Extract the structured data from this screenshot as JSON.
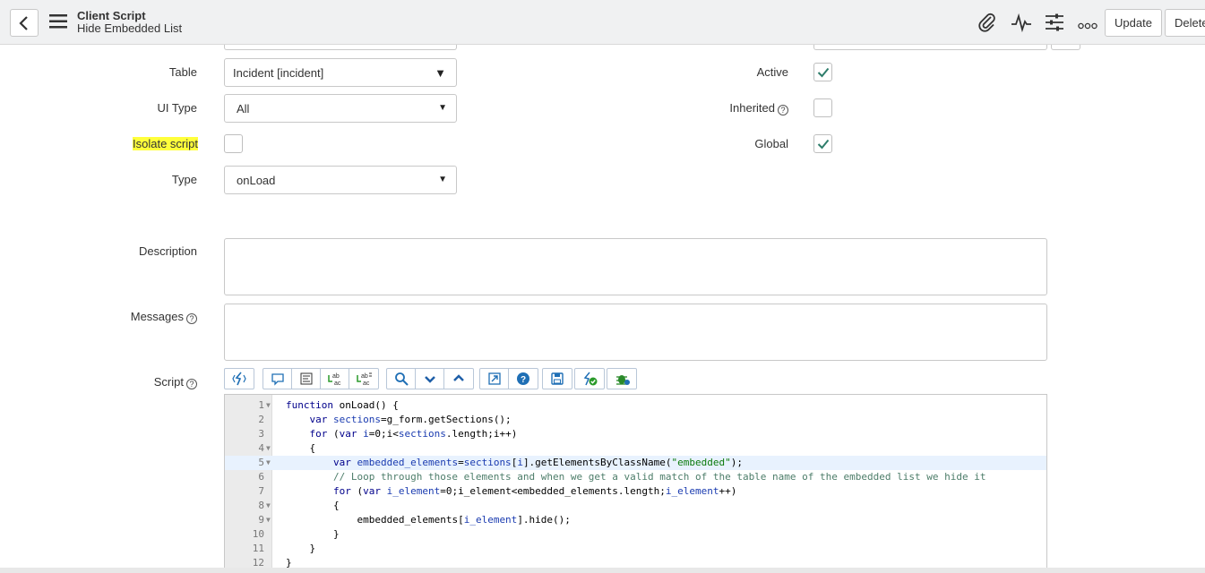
{
  "header": {
    "title": "Client Script",
    "subtitle": "Hide Embedded List",
    "update_label": "Update",
    "delete_label": "Delete"
  },
  "form": {
    "table": {
      "label": "Table",
      "value": "Incident [incident]"
    },
    "ui_type": {
      "label": "UI Type",
      "value": "All"
    },
    "isolate_script": {
      "label": "Isolate script",
      "checked": false
    },
    "type": {
      "label": "Type",
      "value": "onLoad"
    },
    "active": {
      "label": "Active",
      "checked": true
    },
    "inherited": {
      "label": "Inherited",
      "checked": false
    },
    "global": {
      "label": "Global",
      "checked": true
    },
    "description": {
      "label": "Description",
      "value": ""
    },
    "messages": {
      "label": "Messages",
      "value": ""
    },
    "script": {
      "label": "Script"
    }
  },
  "colors": {
    "highlight": "#ffff3b",
    "check": "#2e7d6b",
    "active_line": "#e8f2fe",
    "toolbar_icon": "#1f6fb5"
  },
  "script_toolbar": [
    [
      "toggle-syntax-editor-icon"
    ],
    [
      "comment-icon",
      "format-code-icon",
      "replace-icon",
      "replace-all-icon"
    ],
    [
      "search-icon",
      "search-next-icon",
      "search-prev-icon"
    ],
    [
      "fullscreen-icon",
      "help-icon"
    ],
    [
      "save-icon"
    ],
    [
      "script-check-icon"
    ],
    [
      "debug-icon"
    ]
  ],
  "code_lines": [
    {
      "n": "1",
      "fold": true,
      "indent": "",
      "tokens": [
        [
          "kw",
          "function"
        ],
        [
          "",
          " onLoad() {"
        ]
      ]
    },
    {
      "n": "2",
      "fold": false,
      "indent": "    ",
      "tokens": [
        [
          "kw",
          "var"
        ],
        [
          "",
          " "
        ],
        [
          "var",
          "sections"
        ],
        [
          "",
          "=g_form.getSections();"
        ]
      ]
    },
    {
      "n": "3",
      "fold": false,
      "indent": "    ",
      "tokens": [
        [
          "kw",
          "for"
        ],
        [
          "",
          " ("
        ],
        [
          "kw",
          "var"
        ],
        [
          "",
          " "
        ],
        [
          "var",
          "i"
        ],
        [
          "",
          "=0;i<"
        ],
        [
          "var",
          "sections"
        ],
        [
          "",
          ".length;i++)"
        ]
      ]
    },
    {
      "n": "4",
      "fold": true,
      "indent": "    ",
      "tokens": [
        [
          "",
          "{"
        ]
      ]
    },
    {
      "n": "5",
      "fold": true,
      "indent": "        ",
      "active": true,
      "tokens": [
        [
          "kw",
          "var"
        ],
        [
          "",
          " "
        ],
        [
          "var",
          "embedded_elements"
        ],
        [
          "",
          "="
        ],
        [
          "var",
          "sections"
        ],
        [
          "",
          "["
        ],
        [
          "var",
          "i"
        ],
        [
          "",
          "].getElementsByClassName("
        ],
        [
          "str",
          "\"embedded\""
        ],
        [
          "",
          ");"
        ]
      ]
    },
    {
      "n": "6",
      "fold": false,
      "indent": "        ",
      "tokens": [
        [
          "cmt",
          "// Loop through those elements and when we get a valid match of the table name of the embedded list we hide it"
        ]
      ]
    },
    {
      "n": "7",
      "fold": false,
      "indent": "        ",
      "tokens": [
        [
          "kw",
          "for"
        ],
        [
          "",
          " ("
        ],
        [
          "kw",
          "var"
        ],
        [
          "",
          " "
        ],
        [
          "var",
          "i_element"
        ],
        [
          "",
          "=0;i_element<embedded_elements.length;"
        ],
        [
          "var",
          "i_element"
        ],
        [
          "",
          "++)"
        ]
      ]
    },
    {
      "n": "8",
      "fold": true,
      "indent": "        ",
      "tokens": [
        [
          "",
          "{"
        ]
      ]
    },
    {
      "n": "9",
      "fold": true,
      "indent": "            ",
      "tokens": [
        [
          "",
          "embedded_elements["
        ],
        [
          "var",
          "i_element"
        ],
        [
          "",
          "].hide();"
        ]
      ]
    },
    {
      "n": "10",
      "fold": false,
      "indent": "        ",
      "tokens": [
        [
          "",
          "}"
        ]
      ]
    },
    {
      "n": "11",
      "fold": false,
      "indent": "    ",
      "tokens": [
        [
          "",
          "}"
        ]
      ]
    },
    {
      "n": "12",
      "fold": false,
      "indent": "",
      "tokens": [
        [
          "",
          "}"
        ]
      ]
    }
  ]
}
